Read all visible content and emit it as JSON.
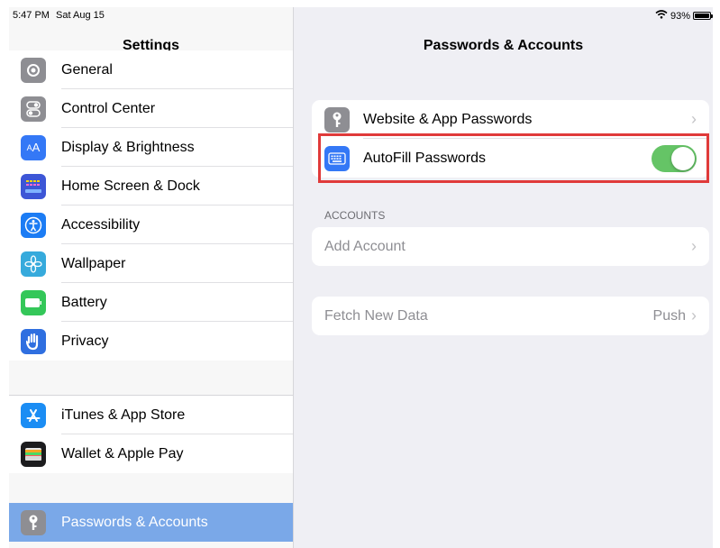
{
  "status": {
    "time": "5:47 PM",
    "date": "Sat Aug 15",
    "battery": "93%"
  },
  "sidebar": {
    "title": "Settings",
    "group1": [
      {
        "label": "General",
        "icon": "gear-icon",
        "color": "#8e8e93"
      },
      {
        "label": "Control Center",
        "icon": "toggles-icon",
        "color": "#8e8e93"
      },
      {
        "label": "Display & Brightness",
        "icon": "text-size-icon",
        "color": "#3478f6"
      },
      {
        "label": "Home Screen & Dock",
        "icon": "home-grid-icon",
        "color": "#3d56d6"
      },
      {
        "label": "Accessibility",
        "icon": "accessibility-icon",
        "color": "#1c7cf4"
      },
      {
        "label": "Wallpaper",
        "icon": "flower-icon",
        "color": "#36aadc"
      },
      {
        "label": "Battery",
        "icon": "battery-icon",
        "color": "#34c759"
      },
      {
        "label": "Privacy",
        "icon": "hand-icon",
        "color": "#2f6fe0"
      }
    ],
    "group2": [
      {
        "label": "iTunes & App Store",
        "icon": "app-store-icon",
        "color": "#1b8df4"
      },
      {
        "label": "Wallet & Apple Pay",
        "icon": "wallet-icon",
        "color": "#1c1c1e"
      }
    ],
    "group3": [
      {
        "label": "Passwords & Accounts",
        "icon": "key-icon",
        "color": "#8e8e93"
      }
    ]
  },
  "main": {
    "title": "Passwords & Accounts",
    "website_passwords": "Website & App Passwords",
    "autofill": "AutoFill Passwords",
    "autofill_on": true,
    "accounts_header": "ACCOUNTS",
    "add_account": "Add Account",
    "fetch_new_data": "Fetch New Data",
    "fetch_value": "Push"
  }
}
